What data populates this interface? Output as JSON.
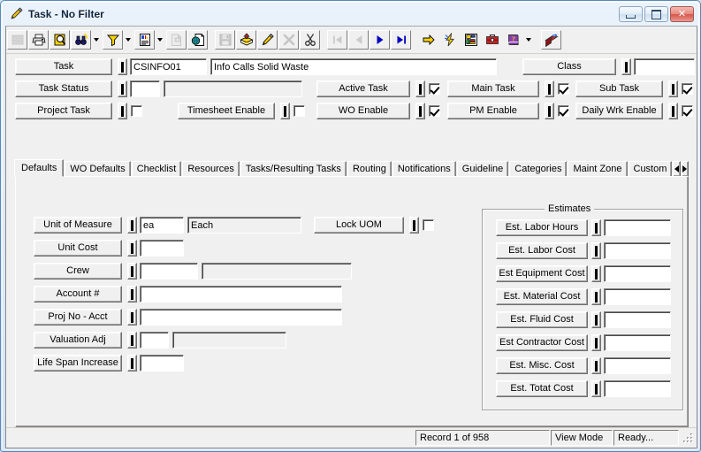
{
  "window": {
    "title": "Task - No Filter",
    "title_icon": "pencil-icon",
    "caption_buttons": [
      {
        "name": "minimize-button",
        "label": "–"
      },
      {
        "name": "maximize-button",
        "label": "□"
      },
      {
        "name": "close-button",
        "label": "✕"
      }
    ]
  },
  "toolbar": {
    "items": [
      {
        "name": "grid-button",
        "icon": "grid-icon",
        "disabled": true
      },
      {
        "name": "print-button",
        "icon": "printer-icon",
        "disabled": false
      },
      {
        "name": "print-preview-button",
        "icon": "print-preview-icon",
        "disabled": false
      },
      {
        "name": "find-button",
        "icon": "binoculars-icon",
        "disabled": false
      },
      {
        "name": "find-dropdown",
        "icon": "chevron-down-icon",
        "disabled": false
      },
      {
        "name": "filter-button",
        "icon": "funnel-icon",
        "disabled": false
      },
      {
        "name": "filter-dropdown",
        "icon": "chevron-down-icon",
        "disabled": false
      },
      {
        "name": "report-button",
        "icon": "report-icon",
        "disabled": false
      },
      {
        "name": "report-dropdown",
        "icon": "chevron-down-icon",
        "disabled": false
      },
      {
        "name": "copy-record-button",
        "icon": "copy-record-icon",
        "disabled": true
      },
      {
        "name": "export-button",
        "icon": "export-globe-icon",
        "disabled": false
      },
      {
        "name": "save-button",
        "icon": "floppy-icon",
        "disabled": true
      },
      {
        "name": "add-button",
        "icon": "add-card-icon",
        "disabled": false
      },
      {
        "name": "edit-button",
        "icon": "pencil-icon",
        "disabled": false
      },
      {
        "name": "delete-button",
        "icon": "x-delete-icon",
        "disabled": true
      },
      {
        "name": "cut-button",
        "icon": "scissors-icon",
        "disabled": false
      },
      {
        "name": "first-record-button",
        "icon": "first-record-icon",
        "disabled": true
      },
      {
        "name": "previous-record-button",
        "icon": "previous-record-icon",
        "disabled": true
      },
      {
        "name": "next-record-button",
        "icon": "next-record-icon",
        "disabled": false
      },
      {
        "name": "last-record-button",
        "icon": "last-record-icon",
        "disabled": false
      },
      {
        "name": "goto-button",
        "icon": "yellow-arrow-icon",
        "disabled": false
      },
      {
        "name": "quick-action-button",
        "icon": "lightning-icon",
        "disabled": false
      },
      {
        "name": "layout-button",
        "icon": "layout-icon",
        "disabled": false
      },
      {
        "name": "toolbox-button",
        "icon": "toolbox-icon",
        "disabled": false
      },
      {
        "name": "help-button",
        "icon": "book-icon",
        "disabled": false
      },
      {
        "name": "help-dropdown",
        "icon": "chevron-down-icon",
        "disabled": false
      },
      {
        "name": "exit-button",
        "icon": "exit-icon",
        "disabled": false
      }
    ]
  },
  "header": {
    "task": {
      "label": "Task",
      "code_value": "CSINFO01",
      "desc_value": "Info Calls Solid Waste"
    },
    "class": {
      "label": "Class",
      "value": ""
    },
    "task_status": {
      "label": "Task Status",
      "code_value": "",
      "desc_value": ""
    },
    "project_task": {
      "label": "Project Task",
      "checked": false
    },
    "timesheet_enable": {
      "label": "Timesheet Enable",
      "checked": false
    },
    "active_task": {
      "label": "Active Task",
      "checked": true
    },
    "main_task": {
      "label": "Main Task",
      "checked": true
    },
    "sub_task": {
      "label": "Sub Task",
      "checked": true
    },
    "wo_enable": {
      "label": "WO Enable",
      "checked": true
    },
    "pm_enable": {
      "label": "PM Enable",
      "checked": true
    },
    "daily_wrk_enable": {
      "label": "Daily Wrk Enable",
      "checked": true
    }
  },
  "tabs": {
    "items": [
      {
        "label": "Defaults",
        "active": true
      },
      {
        "label": "WO Defaults",
        "active": false
      },
      {
        "label": "Checklist",
        "active": false
      },
      {
        "label": "Resources",
        "active": false
      },
      {
        "label": "Tasks/Resulting Tasks",
        "active": false
      },
      {
        "label": "Routing",
        "active": false
      },
      {
        "label": "Notifications",
        "active": false
      },
      {
        "label": "Guideline",
        "active": false
      },
      {
        "label": "Categories",
        "active": false
      },
      {
        "label": "Maint Zone",
        "active": false
      },
      {
        "label": "Custom",
        "active": false
      }
    ],
    "scroll_left": "◄",
    "scroll_right": "►"
  },
  "defaults_tab": {
    "unit_of_measure": {
      "label": "Unit of Measure",
      "code_value": "ea",
      "desc_value": "Each"
    },
    "lock_uom": {
      "label": "Lock UOM",
      "checked": false
    },
    "unit_cost": {
      "label": "Unit Cost",
      "value": ""
    },
    "crew": {
      "label": "Crew",
      "code_value": "",
      "desc_value": ""
    },
    "account_no": {
      "label": "Account #",
      "value": ""
    },
    "proj_no_acct": {
      "label": "Proj No - Acct",
      "value": ""
    },
    "valuation_adj": {
      "label": "Valuation Adj",
      "code_value": "",
      "desc_value": ""
    },
    "life_span_increase": {
      "label": "Life Span Increase",
      "value": ""
    }
  },
  "estimates": {
    "title": "Estimates",
    "rows": [
      {
        "label": "Est. Labor Hours",
        "value": ""
      },
      {
        "label": "Est. Labor Cost",
        "value": ""
      },
      {
        "label": "Est Equipment Cost",
        "value": ""
      },
      {
        "label": "Est. Material Cost",
        "value": ""
      },
      {
        "label": "Est. Fluid Cost",
        "value": ""
      },
      {
        "label": "Est Contractor Cost",
        "value": ""
      },
      {
        "label": "Est. Misc. Cost",
        "value": ""
      },
      {
        "label": "Est. Totat Cost",
        "value": ""
      }
    ]
  },
  "statusbar": {
    "record": "Record 1 of 958",
    "mode": "View Mode",
    "state": "Ready..."
  },
  "colors": {
    "window_frame": "#5b89b5",
    "client_bg": "#f0f0f0",
    "field_bg": "#ffffff",
    "accent_yellow": "#ffd400",
    "accent_blue": "#0000c0",
    "accent_red": "#c00000"
  }
}
